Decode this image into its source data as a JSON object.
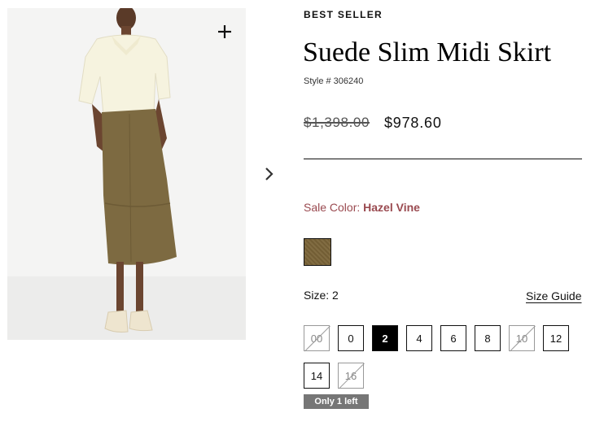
{
  "product": {
    "badge": "BEST SELLER",
    "title": "Suede Slim Midi Skirt",
    "style_number": "Style # 306240",
    "price_original": "$1,398.00",
    "price_sale": "$978.60"
  },
  "gallery": {
    "zoom_icon": "plus-icon",
    "next_icon": "chevron-right-icon"
  },
  "color": {
    "label": "Sale Color:",
    "name": "Hazel Vine",
    "swatch_hex": "#7a6438",
    "label_hex": "#9a4a50"
  },
  "size": {
    "label": "Size: 2",
    "guide_label": "Size Guide",
    "options": [
      {
        "label": "00",
        "available": false,
        "selected": false
      },
      {
        "label": "0",
        "available": true,
        "selected": false
      },
      {
        "label": "2",
        "available": true,
        "selected": true
      },
      {
        "label": "4",
        "available": true,
        "selected": false
      },
      {
        "label": "6",
        "available": true,
        "selected": false
      },
      {
        "label": "8",
        "available": true,
        "selected": false
      },
      {
        "label": "10",
        "available": false,
        "selected": false
      },
      {
        "label": "12",
        "available": true,
        "selected": false
      },
      {
        "label": "14",
        "available": true,
        "selected": false
      },
      {
        "label": "16",
        "available": false,
        "selected": false
      }
    ],
    "stock_note": "Only 1 left"
  }
}
